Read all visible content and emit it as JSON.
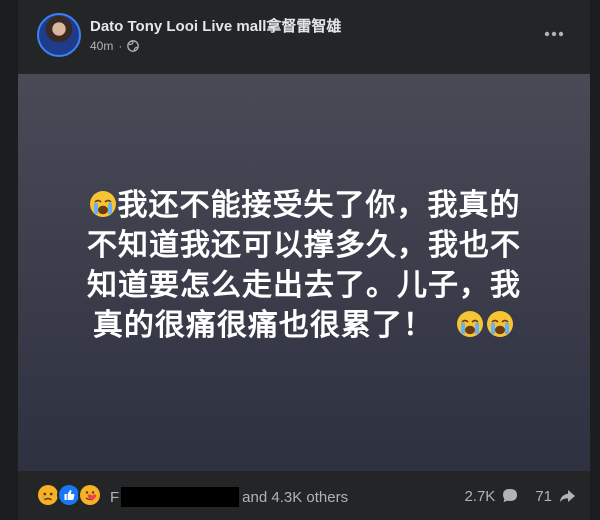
{
  "post": {
    "author": "Dato Tony Looi Live mall拿督雷智雄",
    "time": "40m",
    "separator": "·",
    "privacy_icon": "globe-icon",
    "menu_icon": "more-horizontal-icon",
    "text_line1": "我还不能接受失了你，我真的",
    "text_line2": "不知道我还可以撑多久，我也不",
    "text_line3": "知道要怎么走出去了。儿子，我",
    "text_line4": "真的很痛很痛也很累了！",
    "emoji": "crying-face-emoji",
    "background_colors": [
      "#4a4a57",
      "#2e3140"
    ]
  },
  "footer": {
    "reaction_icons": [
      "sad-reaction-icon",
      "like-reaction-icon",
      "care-reaction-icon"
    ],
    "names_prefix": "F",
    "names_suffix": "and 4.3K others",
    "comment_count": "2.7K",
    "share_count": "71"
  },
  "colors": {
    "card_bg": "#242526",
    "text_secondary": "#b0b3b8",
    "like_blue": "#1877f2",
    "sad_yellow": "#f7b125"
  }
}
